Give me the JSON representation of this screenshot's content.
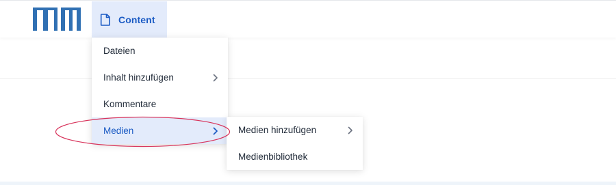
{
  "header": {
    "logo_text": "TUM",
    "tab": {
      "label": "Content",
      "icon": "file-icon"
    }
  },
  "menu": {
    "items": [
      {
        "label": "Dateien"
      },
      {
        "label": "Inhalt hinzufügen",
        "has_submenu": true
      },
      {
        "label": "Kommentare"
      },
      {
        "label": "Medien",
        "has_submenu": true,
        "active": true
      }
    ]
  },
  "submenu": {
    "items": [
      {
        "label": "Medien hinzufügen",
        "has_submenu": true
      },
      {
        "label": "Medienbibliothek"
      }
    ]
  },
  "colors": {
    "accent": "#1b5bc4",
    "active_bg": "#e3ebfb",
    "logo": "#3070b3",
    "annotation": "#d8335b"
  }
}
